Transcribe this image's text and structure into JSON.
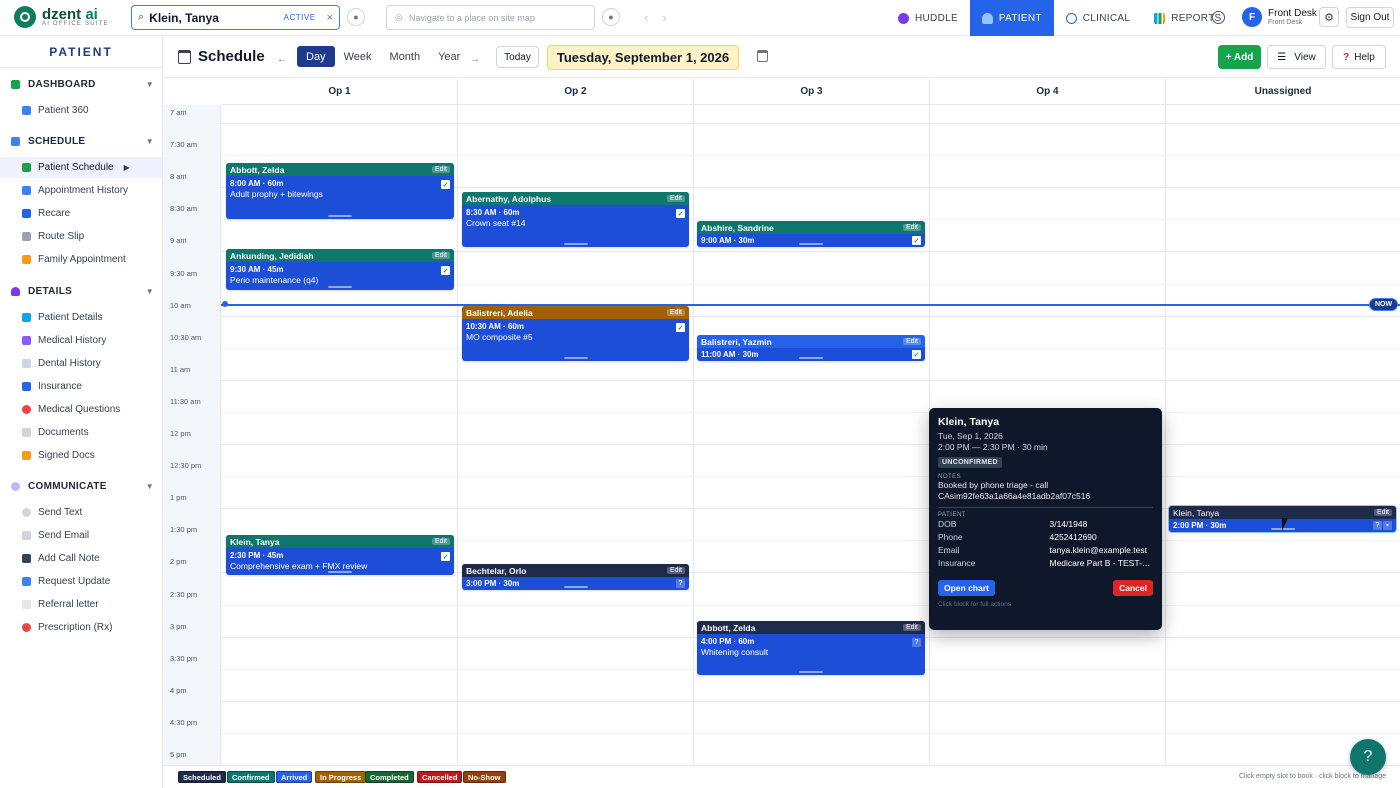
{
  "brand": {
    "name_a": "dzent",
    "name_b": " ai",
    "sub": "AI OFFICE SUITE"
  },
  "search": {
    "value": "Klein, Tanya",
    "status": "ACTIVE",
    "clear": "×",
    "icon": "search-icon"
  },
  "navsearch": {
    "placeholder": "Navigate to a place on site map"
  },
  "topnav": [
    {
      "label": "HUDDLE",
      "icon": "huddle-icon",
      "color": "#7c3aed"
    },
    {
      "label": "PATIENT",
      "icon": "patient-icon",
      "color": "#ffffff"
    },
    {
      "label": "CLINICAL",
      "icon": "stethoscope-icon",
      "color": "#2563eb"
    },
    {
      "label": "REPORTS",
      "icon": "chart-icon",
      "color": "#0ea5e9"
    }
  ],
  "user": {
    "initial": "F",
    "name": "Front Desk",
    "role": "Front Desk",
    "signout": "Sign Out"
  },
  "sidebar": {
    "title": "PATIENT",
    "sections": [
      {
        "label": "DASHBOARD",
        "color": "#16a34a",
        "items": [
          {
            "label": "Patient 360",
            "color": "#3b82f6"
          }
        ]
      },
      {
        "label": "SCHEDULE",
        "color": "#3b82f6",
        "items": [
          {
            "label": "Patient Schedule",
            "color": "#16a34a",
            "active": true
          },
          {
            "label": "Appointment History",
            "color": "#3b82f6"
          },
          {
            "label": "Recare",
            "color": "#2563eb"
          },
          {
            "label": "Route Slip",
            "color": "#6b7280"
          },
          {
            "label": "Family Appointment",
            "color": "#f59e0b"
          }
        ]
      },
      {
        "label": "DETAILS",
        "color": "#7c3aed",
        "items": [
          {
            "label": "Patient Details",
            "color": "#0ea5e9"
          },
          {
            "label": "Medical History",
            "color": "#8b5cf6"
          },
          {
            "label": "Dental History",
            "color": "#9ca3af"
          },
          {
            "label": "Insurance",
            "color": "#2563eb"
          },
          {
            "label": "Medical Questions",
            "color": "#ef4444"
          },
          {
            "label": "Documents",
            "color": "#9ca3af"
          },
          {
            "label": "Signed Docs",
            "color": "#f59e0b"
          }
        ]
      },
      {
        "label": "COMMUNICATE",
        "color": "#a78bfa",
        "items": [
          {
            "label": "Send Text",
            "color": "#9ca3af"
          },
          {
            "label": "Send Email",
            "color": "#9ca3af"
          },
          {
            "label": "Add Call Note",
            "color": "#374151"
          },
          {
            "label": "Request Update",
            "color": "#3b82f6"
          },
          {
            "label": "Referral letter",
            "color": "#9ca3af"
          },
          {
            "label": "Prescription (Rx)",
            "color": "#ef4444"
          }
        ]
      }
    ]
  },
  "toolbar": {
    "title": "Schedule",
    "prev": "←",
    "next": "→",
    "views": [
      "Day",
      "Week",
      "Month",
      "Year"
    ],
    "active_view": "Day",
    "today": "Today",
    "date": "Tuesday, September 1, 2026",
    "add": "+ Add",
    "view": "View",
    "help": "Help"
  },
  "columns": [
    "Op 1",
    "Op 2",
    "Op 3",
    "Op 4",
    "Unassigned"
  ],
  "times": [
    "7 am",
    "7:30 am",
    "8 am",
    "8:30 am",
    "9 am",
    "9:30 am",
    "10 am",
    "10:30 am",
    "11 am",
    "11:30 am",
    "12 pm",
    "12:30 pm",
    "1 pm",
    "1:30 pm",
    "2 pm",
    "2:30 pm",
    "3 pm",
    "3:30 pm",
    "4 pm",
    "4:30 pm",
    "5 pm"
  ],
  "now_label": "NOW",
  "appointments": [
    {
      "name": "Abbott, Zelda",
      "time": "8:00 AM · 60m",
      "desc": "Adult prophy + bitewings",
      "status": "confirmed",
      "mark": "✓",
      "edit": "Edit"
    },
    {
      "name": "Abernathy, Adolphus",
      "time": "8:30 AM · 60m",
      "desc": "Crown seat #14",
      "status": "confirmed",
      "mark": "✓",
      "edit": "Edit"
    },
    {
      "name": "Abshire, Sandrine",
      "time": "9:00 AM · 30m",
      "desc": "",
      "status": "confirmed",
      "mark": "✓",
      "edit": "Edit"
    },
    {
      "name": "Ankunding, Jedidiah",
      "time": "9:30 AM · 45m",
      "desc": "Perio maintenance (q4)",
      "status": "confirmed",
      "mark": "✓",
      "edit": "Edit"
    },
    {
      "name": "Balistreri, Adelia",
      "time": "10:30 AM · 60m",
      "desc": "MO composite #5",
      "status": "in-progress",
      "mark": "✓",
      "edit": "Edit"
    },
    {
      "name": "Balistreri, Yazmin",
      "time": "11:00 AM · 30m",
      "desc": "",
      "status": "arrived",
      "mark": "✓",
      "edit": "Edit"
    },
    {
      "name": "Klein, Tanya",
      "time": "2:30 PM · 45m",
      "desc": "Comprehensive exam + FMX review",
      "status": "confirmed",
      "mark": "✓",
      "edit": "Edit"
    },
    {
      "name": "Bechtelar, Orlo",
      "time": "3:00 PM · 30m",
      "desc": "",
      "status": "scheduled",
      "mark": "?",
      "edit": "Edit"
    },
    {
      "name": "Abbott, Zelda",
      "time": "4:00 PM · 60m",
      "desc": "Whitening consult",
      "status": "scheduled",
      "mark": "?",
      "edit": "Edit"
    },
    {
      "name": "Klein, Tanya",
      "time": "2:00 PM · 30m",
      "desc": "",
      "status": "scheduled",
      "mark": "?",
      "edit": "Edit"
    }
  ],
  "popup": {
    "name": "Klein, Tanya",
    "date": "Tue, Sep 1, 2026",
    "time": "2:00 PM — 2:30 PM · 30 min",
    "badge": "UNCONFIRMED",
    "notes_label": "NOTES",
    "notes": "Booked by phone triage - call",
    "notes2": "CAsim92fe63a1a66a4e81adb2af07c516",
    "patient_label": "PATIENT",
    "fields": [
      {
        "k": "DOB",
        "v": "3/14/1948"
      },
      {
        "k": "Phone",
        "v": "4252412690"
      },
      {
        "k": "Email",
        "v": "tanya.klein@example.test"
      },
      {
        "k": "Insurance",
        "v": "Medicare Part B - TEST-M..."
      }
    ],
    "open": "Open chart",
    "cancel": "Cancel",
    "hint": "Click block for full actions"
  },
  "legend": [
    {
      "label": "Scheduled",
      "color": "#1e2a4a"
    },
    {
      "label": "Confirmed",
      "color": "#0f766e"
    },
    {
      "label": "Arrived",
      "color": "#2563eb"
    },
    {
      "label": "In Progress",
      "color": "#a16207"
    },
    {
      "label": "Completed",
      "color": "#166534"
    },
    {
      "label": "Cancelled",
      "color": "#b91c1c"
    },
    {
      "label": "No-Show",
      "color": "#92400e"
    }
  ],
  "legend_hint": "Click empty slot to book · click block to manage",
  "fab": "?"
}
